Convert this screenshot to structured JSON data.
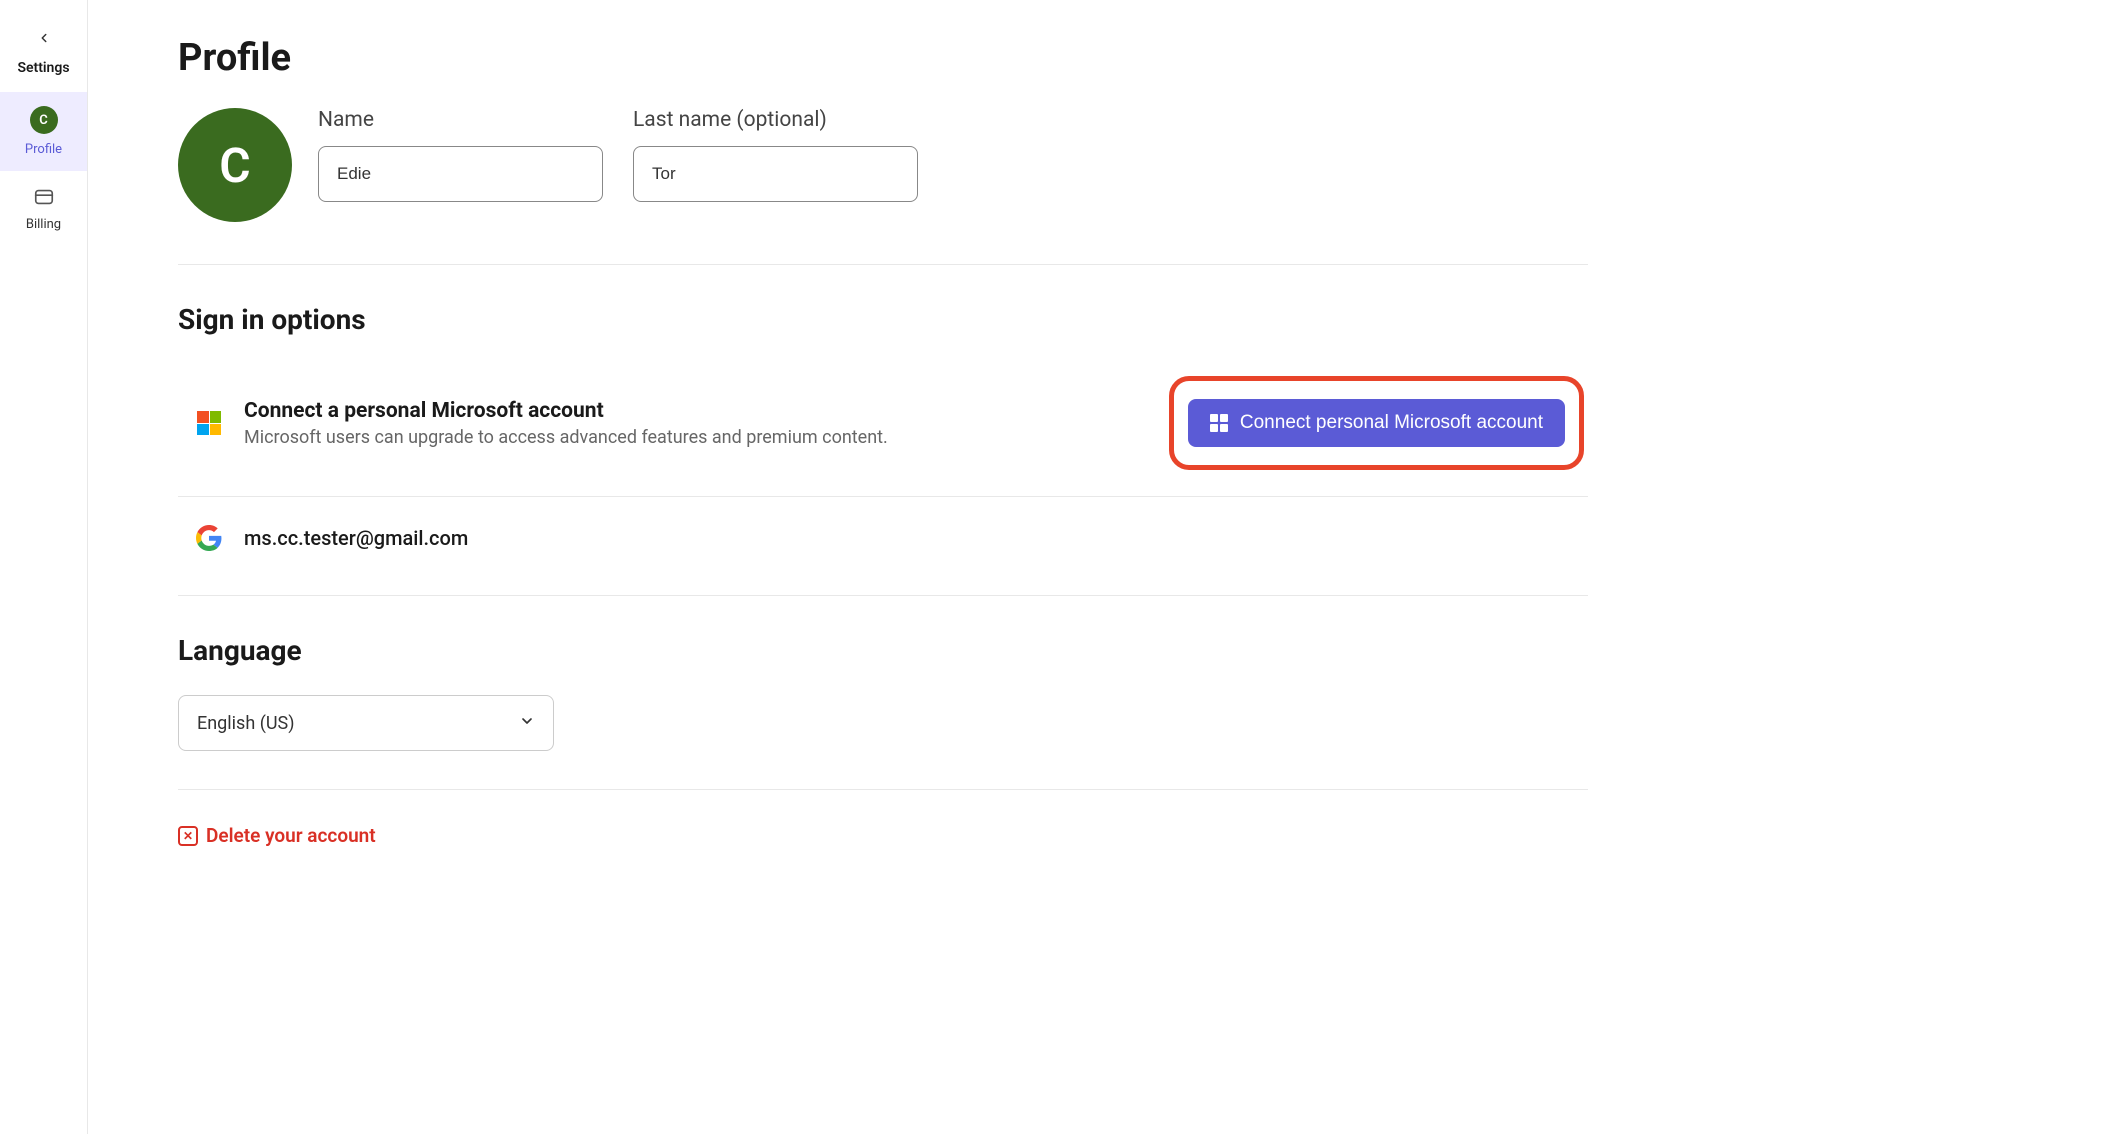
{
  "sidebar": {
    "back_label": "Settings",
    "items": [
      {
        "label": "Profile",
        "avatar_letter": "C"
      },
      {
        "label": "Billing"
      }
    ]
  },
  "main": {
    "title": "Profile",
    "avatar_letter": "C",
    "name": {
      "first_label": "Name",
      "first_value": "Edie",
      "last_label": "Last name (optional)",
      "last_value": "Tor"
    },
    "signin": {
      "section_title": "Sign in options",
      "microsoft": {
        "title": "Connect a personal Microsoft account",
        "subtitle": "Microsoft users can upgrade to access advanced features and premium content.",
        "button_label": "Connect personal Microsoft account"
      },
      "google": {
        "email": "ms.cc.tester@gmail.com"
      }
    },
    "language": {
      "section_title": "Language",
      "selected": "English (US)"
    },
    "delete": {
      "label": "Delete your account"
    }
  },
  "colors": {
    "accent": "#5b5bd6",
    "avatar_bg": "#3a6b1f",
    "highlight": "#e8442a",
    "danger": "#d93025"
  }
}
